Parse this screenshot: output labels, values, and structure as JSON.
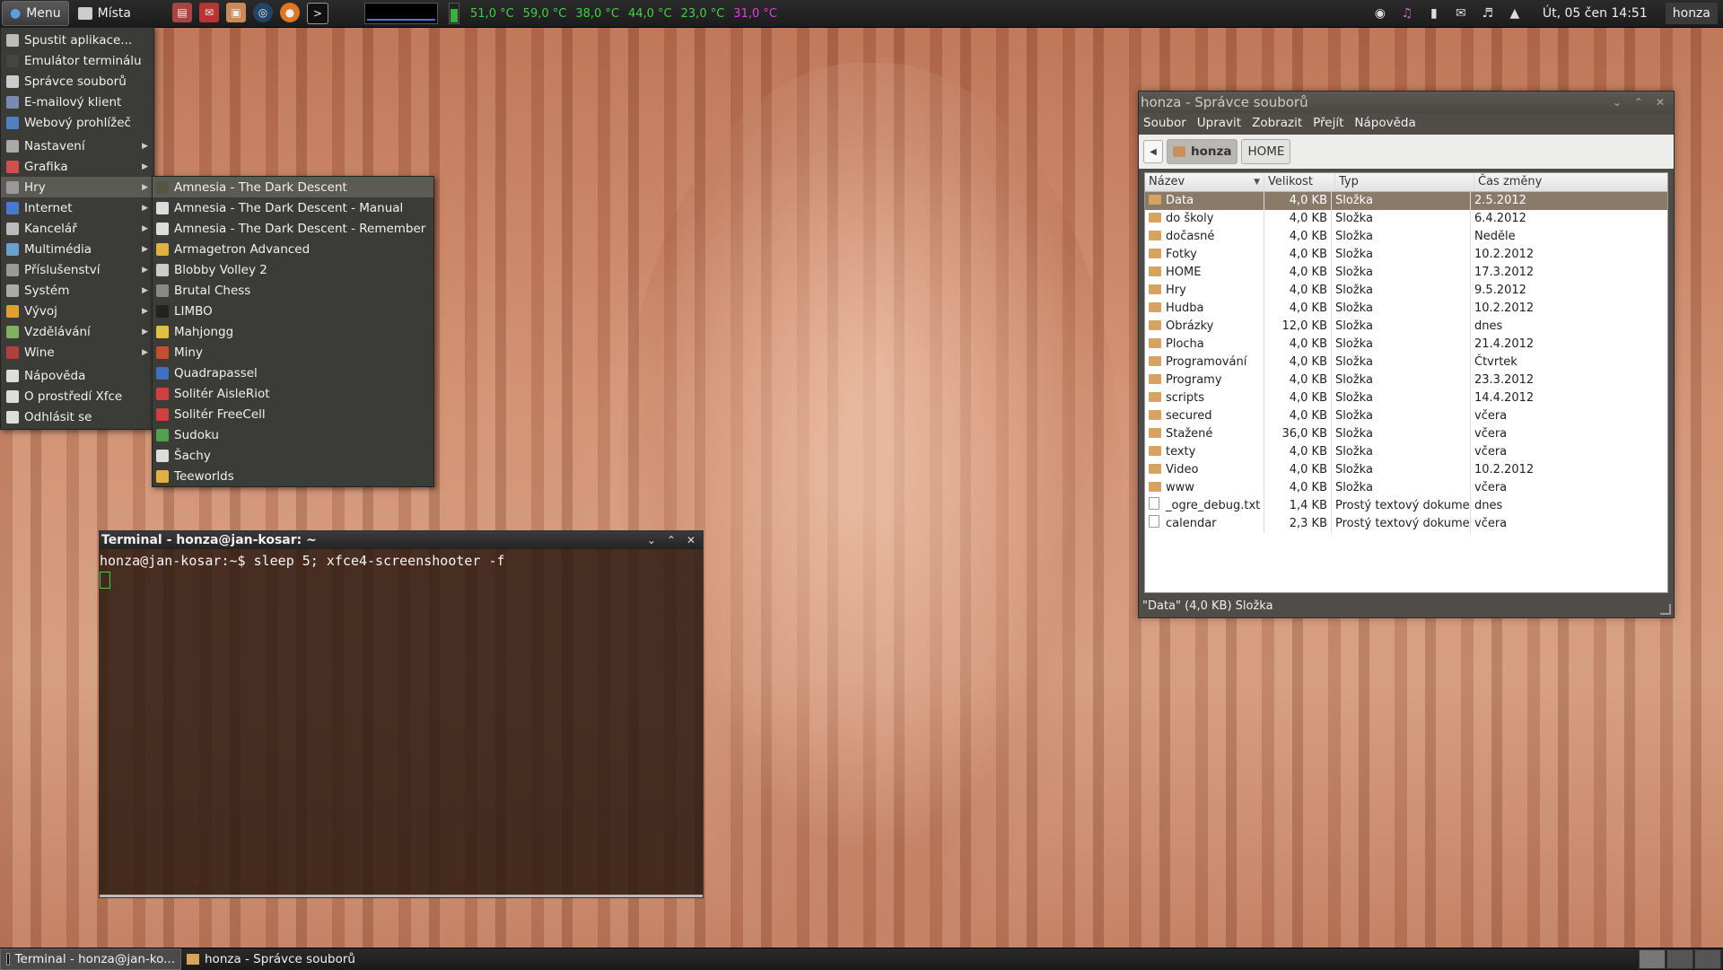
{
  "top_panel": {
    "menu_label": "Menu",
    "places_label": "Místa",
    "launchers": [
      "archive-icon",
      "mail-icon",
      "files-icon",
      "browser-icon",
      "firefox-icon",
      "terminal-icon"
    ],
    "temps": [
      "51,0 °C",
      "59,0 °C",
      "38,0 °C",
      "44,0 °C",
      "23,0 °C",
      "31,0 °C"
    ],
    "clock": "Út, 05 čen  14:51",
    "user": "honza",
    "colors": {
      "temp_normal": "#3fd23f",
      "temp_alert": "#e040e0"
    }
  },
  "menu": {
    "items": [
      {
        "label": "Spustit aplikace...",
        "icon": "gear-icon",
        "color": "#bbbbbb",
        "sub": false
      },
      {
        "label": "Emulátor terminálu",
        "icon": "terminal-icon",
        "color": "#444444",
        "sub": false
      },
      {
        "label": "Správce souborů",
        "icon": "files-icon",
        "color": "#cccccc",
        "sub": false
      },
      {
        "label": "E-mailový klient",
        "icon": "mail-icon",
        "color": "#7a8ab0",
        "sub": false
      },
      {
        "label": "Webový prohlížeč",
        "icon": "browser-icon",
        "color": "#5080c0",
        "sub": false
      },
      {
        "label": "Nastavení",
        "icon": "settings-icon",
        "color": "#aaaaaa",
        "sub": true
      },
      {
        "label": "Grafika",
        "icon": "graphics-icon",
        "color": "#d05050",
        "sub": true
      },
      {
        "label": "Hry",
        "icon": "games-icon",
        "color": "#999999",
        "sub": true,
        "selected": true
      },
      {
        "label": "Internet",
        "icon": "internet-icon",
        "color": "#4a7ad0",
        "sub": true
      },
      {
        "label": "Kancelář",
        "icon": "office-icon",
        "color": "#bbbbbb",
        "sub": true
      },
      {
        "label": "Multimédia",
        "icon": "multimedia-icon",
        "color": "#6aa0d0",
        "sub": true
      },
      {
        "label": "Příslušenství",
        "icon": "accessories-icon",
        "color": "#999999",
        "sub": true
      },
      {
        "label": "Systém",
        "icon": "system-icon",
        "color": "#aaaaaa",
        "sub": true
      },
      {
        "label": "Vývoj",
        "icon": "development-icon",
        "color": "#e0a030",
        "sub": true
      },
      {
        "label": "Vzdělávání",
        "icon": "education-icon",
        "color": "#80b060",
        "sub": true
      },
      {
        "label": "Wine",
        "icon": "wine-icon",
        "color": "#b04040",
        "sub": true
      },
      {
        "label": "Nápověda",
        "icon": "help-icon",
        "color": "#dddddd",
        "sub": false
      },
      {
        "label": "O prostředí Xfce",
        "icon": "info-icon",
        "color": "#dddddd",
        "sub": false
      },
      {
        "label": "Odhlásit se",
        "icon": "logout-icon",
        "color": "#dddddd",
        "sub": false
      }
    ]
  },
  "games_submenu": {
    "items": [
      {
        "label": "Amnesia - The Dark Descent",
        "icon": "amnesia-icon",
        "color": "#555544",
        "selected": true
      },
      {
        "label": "Amnesia - The Dark Descent - Manual",
        "icon": "document-icon",
        "color": "#dddddd"
      },
      {
        "label": "Amnesia - The Dark Descent - Remember",
        "icon": "document-icon",
        "color": "#dddddd"
      },
      {
        "label": "Armagetron Advanced",
        "icon": "armagetron-icon",
        "color": "#e0b040"
      },
      {
        "label": "Blobby Volley 2",
        "icon": "blobby-icon",
        "color": "#cccccc"
      },
      {
        "label": "Brutal Chess",
        "icon": "chess-board-icon",
        "color": "#888888"
      },
      {
        "label": "LIMBO",
        "icon": "limbo-icon",
        "color": "#222222"
      },
      {
        "label": "Mahjongg",
        "icon": "mahjongg-icon",
        "color": "#e0c040"
      },
      {
        "label": "Miny",
        "icon": "mines-icon",
        "color": "#c05030"
      },
      {
        "label": "Quadrapassel",
        "icon": "quadrapassel-icon",
        "color": "#4070c0"
      },
      {
        "label": "Solitér AisleRiot",
        "icon": "cards-icon",
        "color": "#d04040"
      },
      {
        "label": "Solitér FreeCell",
        "icon": "cards-icon",
        "color": "#d04040"
      },
      {
        "label": "Sudoku",
        "icon": "sudoku-icon",
        "color": "#50a050"
      },
      {
        "label": "Šachy",
        "icon": "chess-icon",
        "color": "#dddddd"
      },
      {
        "label": "Teeworlds",
        "icon": "teeworlds-icon",
        "color": "#e0b040"
      }
    ]
  },
  "terminal": {
    "title": "Terminal - honza@jan-kosar: ~",
    "line1": "honza@jan-kosar:~$ sleep 5; xfce4-screenshooter -f"
  },
  "file_manager": {
    "title": "honza - Správce souborů",
    "menubar": [
      "Soubor",
      "Upravit",
      "Zobrazit",
      "Přejít",
      "Nápověda"
    ],
    "breadcrumbs": [
      {
        "label": "honza",
        "active": true
      },
      {
        "label": "HOME",
        "active": false
      }
    ],
    "columns": {
      "name": "Název",
      "size": "Velikost",
      "type": "Typ",
      "date": "Čas změny"
    },
    "rows": [
      {
        "name": "Data",
        "size": "4,0 KB",
        "type": "Složka",
        "date": "2.5.2012",
        "kind": "folder",
        "selected": true
      },
      {
        "name": "do školy",
        "size": "4,0 KB",
        "type": "Složka",
        "date": "6.4.2012",
        "kind": "folder"
      },
      {
        "name": "dočasné",
        "size": "4,0 KB",
        "type": "Složka",
        "date": "Neděle",
        "kind": "folder"
      },
      {
        "name": "Fotky",
        "size": "4,0 KB",
        "type": "Složka",
        "date": "10.2.2012",
        "kind": "folder"
      },
      {
        "name": "HOME",
        "size": "4,0 KB",
        "type": "Složka",
        "date": "17.3.2012",
        "kind": "folder"
      },
      {
        "name": "Hry",
        "size": "4,0 KB",
        "type": "Složka",
        "date": "9.5.2012",
        "kind": "folder"
      },
      {
        "name": "Hudba",
        "size": "4,0 KB",
        "type": "Složka",
        "date": "10.2.2012",
        "kind": "folder"
      },
      {
        "name": "Obrázky",
        "size": "12,0 KB",
        "type": "Složka",
        "date": "dnes",
        "kind": "folder"
      },
      {
        "name": "Plocha",
        "size": "4,0 KB",
        "type": "Složka",
        "date": "21.4.2012",
        "kind": "folder"
      },
      {
        "name": "Programování",
        "size": "4,0 KB",
        "type": "Složka",
        "date": "Čtvrtek",
        "kind": "folder"
      },
      {
        "name": "Programy",
        "size": "4,0 KB",
        "type": "Složka",
        "date": "23.3.2012",
        "kind": "folder"
      },
      {
        "name": "scripts",
        "size": "4,0 KB",
        "type": "Složka",
        "date": "14.4.2012",
        "kind": "folder"
      },
      {
        "name": "secured",
        "size": "4,0 KB",
        "type": "Složka",
        "date": "včera",
        "kind": "folder"
      },
      {
        "name": "Stažené",
        "size": "36,0 KB",
        "type": "Složka",
        "date": "včera",
        "kind": "folder"
      },
      {
        "name": "texty",
        "size": "4,0 KB",
        "type": "Složka",
        "date": "včera",
        "kind": "folder"
      },
      {
        "name": "Video",
        "size": "4,0 KB",
        "type": "Složka",
        "date": "10.2.2012",
        "kind": "folder"
      },
      {
        "name": "www",
        "size": "4,0 KB",
        "type": "Složka",
        "date": "včera",
        "kind": "folder"
      },
      {
        "name": "_ogre_debug.txt",
        "size": "1,4 KB",
        "type": "Prostý textový dokument",
        "date": "dnes",
        "kind": "doc"
      },
      {
        "name": "calendar",
        "size": "2,3 KB",
        "type": "Prostý textový dokument",
        "date": "včera",
        "kind": "doc"
      }
    ],
    "status": "\"Data\" (4,0 KB) Složka"
  },
  "taskbar": {
    "tasks": [
      {
        "label": "Terminal - honza@jan-ko...",
        "icon": "terminal-icon",
        "active": true
      },
      {
        "label": "honza - Správce souborů",
        "icon": "folder-icon",
        "active": false
      }
    ]
  }
}
